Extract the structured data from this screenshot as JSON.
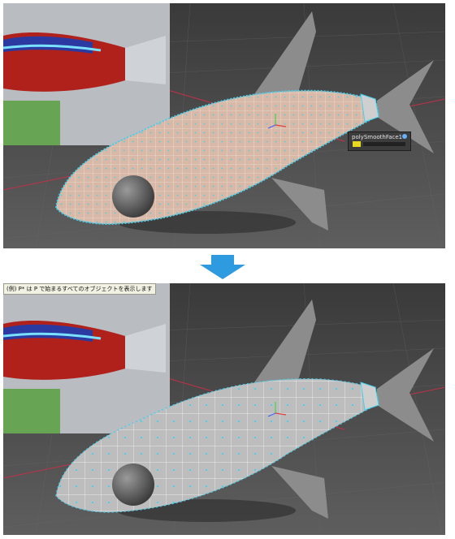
{
  "hud_node_name": "polySmoothFace1",
  "help_line": "(例) P* は P で始まるすべてのオブジェクトを表示します",
  "icons": {
    "arrow": "down-arrow-icon",
    "manipulator": "transform-manipulator-icon"
  },
  "colors": {
    "viewport_bg": "#5a5a5a",
    "mesh_shaded": "#d8b8a6",
    "mesh_unshaded": "#c0c0c0",
    "wire": "#ffffff",
    "vertex": "#3fd2f2",
    "arrow": "#2e9ae0",
    "grid_axis": "#c0304a"
  }
}
